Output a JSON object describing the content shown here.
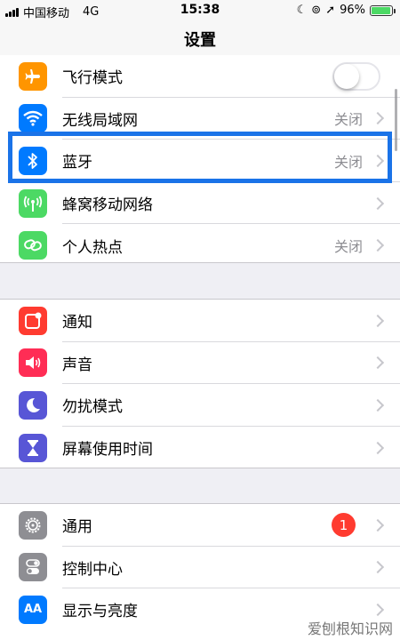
{
  "status_bar": {
    "carrier": "中国移动",
    "network": "4G",
    "time": "15:38",
    "battery_percent": "96%",
    "battery_level": 0.96
  },
  "nav": {
    "title": "设置"
  },
  "group1": {
    "airplane": {
      "label": "飞行模式",
      "icon": "airplane-icon",
      "color": "#ff9500",
      "toggle_on": false
    },
    "wifi": {
      "label": "无线局域网",
      "value": "关闭",
      "icon": "wifi-icon",
      "color": "#007aff"
    },
    "bluetooth": {
      "label": "蓝牙",
      "value": "关闭",
      "icon": "bluetooth-icon",
      "color": "#007aff"
    },
    "cellular": {
      "label": "蜂窝移动网络",
      "icon": "antenna-icon",
      "color": "#4cd964"
    },
    "hotspot": {
      "label": "个人热点",
      "value": "关闭",
      "icon": "hotspot-icon",
      "color": "#4cd964"
    }
  },
  "group2": {
    "notifications": {
      "label": "通知",
      "icon": "notification-icon",
      "color": "#ff3b30"
    },
    "sounds": {
      "label": "声音",
      "icon": "speaker-icon",
      "color": "#ff2d55"
    },
    "dnd": {
      "label": "勿扰模式",
      "icon": "moon-icon",
      "color": "#5856d6"
    },
    "screentime": {
      "label": "屏幕使用时间",
      "icon": "hourglass-icon",
      "color": "#5856d6"
    }
  },
  "group3": {
    "general": {
      "label": "通用",
      "badge": "1",
      "icon": "gear-icon",
      "color": "#8e8e93"
    },
    "control_center": {
      "label": "控制中心",
      "icon": "toggles-icon",
      "color": "#8e8e93"
    },
    "display": {
      "label": "显示与亮度",
      "icon_text": "AA",
      "icon": "text-size-icon",
      "color": "#007aff"
    }
  },
  "watermark": "爱刨根知识网",
  "highlight_color": "#1a73e8"
}
